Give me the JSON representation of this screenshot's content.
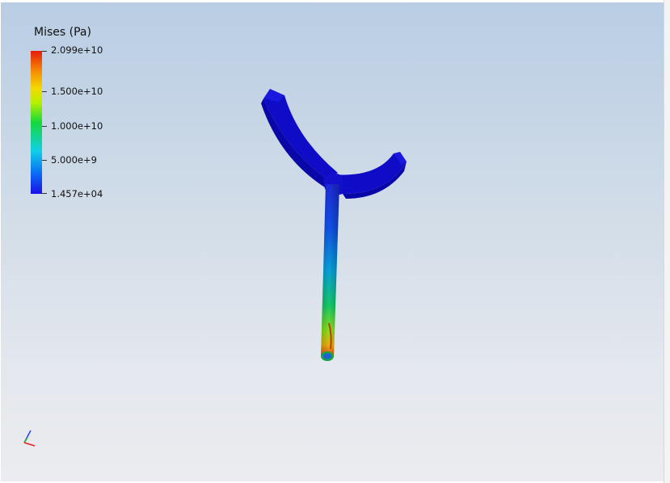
{
  "legend": {
    "title": "Mises (Pa)",
    "labels": [
      "2.099e+10",
      "1.500e+10",
      "1.000e+10",
      "5.000e+9",
      "1.457e+04"
    ],
    "min_value": 14570,
    "max_value": 20990000000
  },
  "scene": {
    "model": "y-shaped-fork",
    "low_stress_color": "#1208d6",
    "high_stress_color": "#e61b0b"
  },
  "axes_triad": {
    "x_color": "#e02020",
    "y_color": "#20c020",
    "z_color": "#2040ff"
  }
}
